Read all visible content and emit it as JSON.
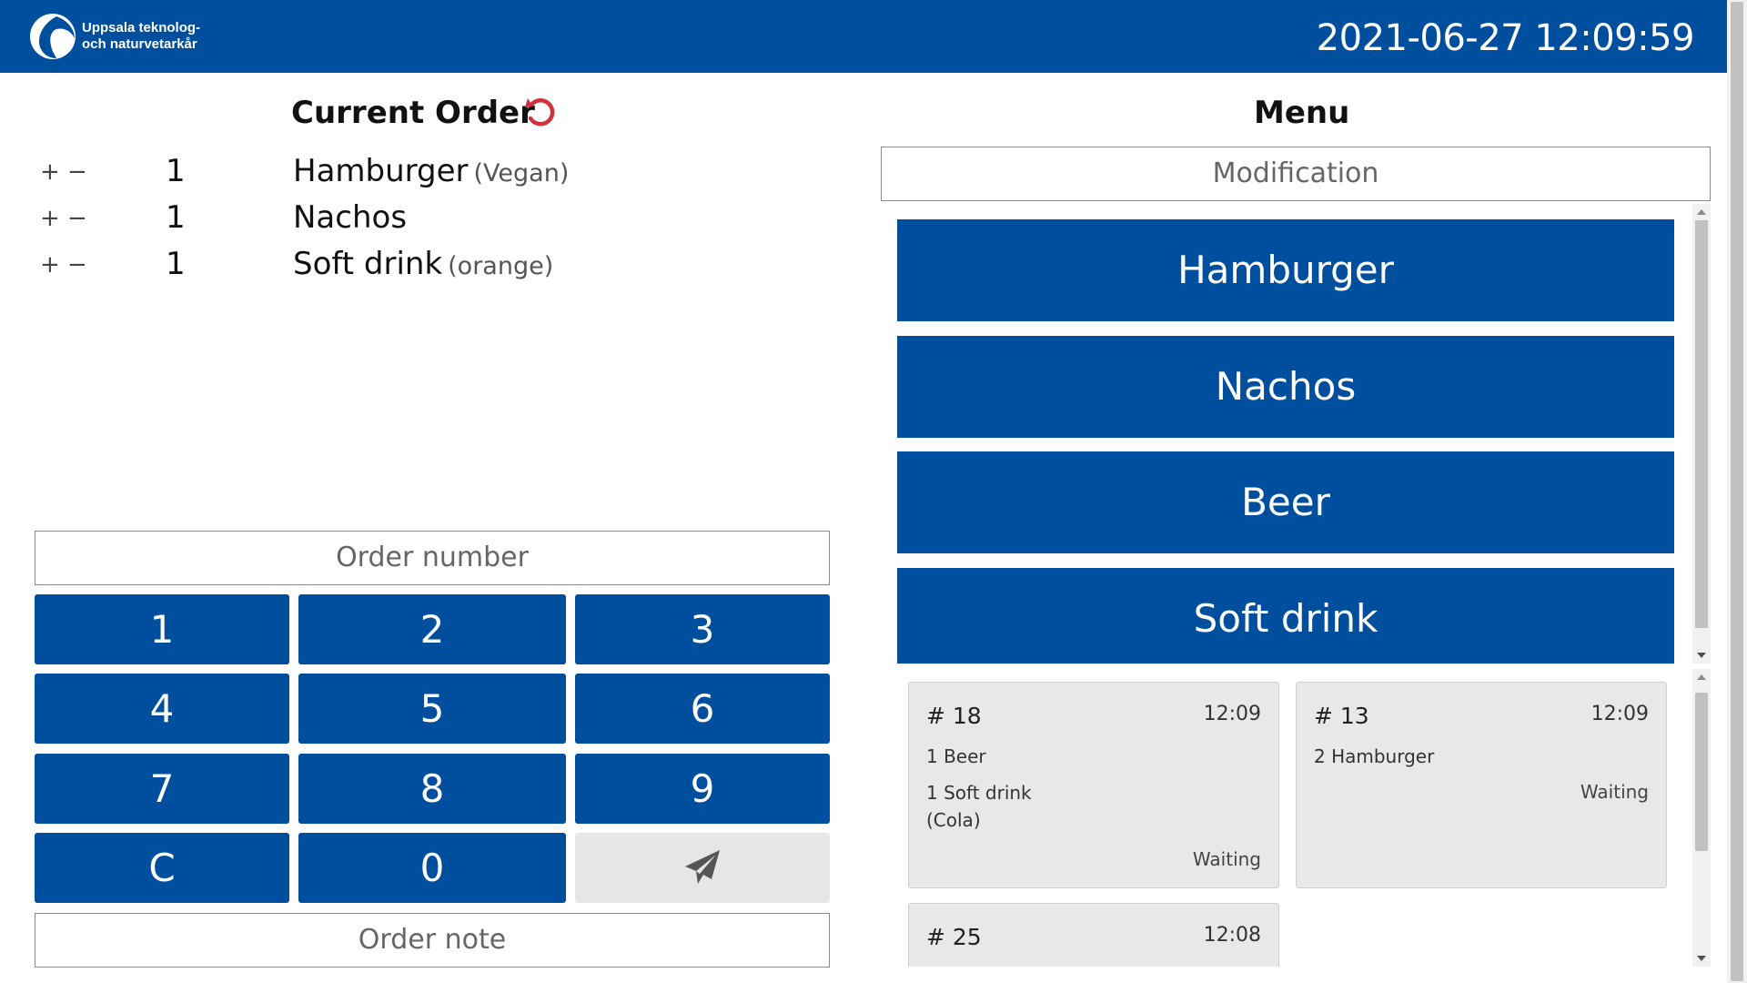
{
  "header": {
    "logo_line1": "Uppsala teknolog-",
    "logo_line2": "och naturvetarkår",
    "clock": "2021-06-27 12:09:59",
    "bg_color": "#004f9e"
  },
  "current_order": {
    "title": "Current Order",
    "undo_icon": "undo-icon",
    "plus_label": "+",
    "minus_label": "−",
    "items": [
      {
        "qty": "1",
        "name": "Hamburger",
        "modifier": "(Vegan)"
      },
      {
        "qty": "1",
        "name": "Nachos",
        "modifier": ""
      },
      {
        "qty": "1",
        "name": "Soft drink",
        "modifier": "(orange)"
      }
    ]
  },
  "order_number": {
    "placeholder": "Order number"
  },
  "keypad": {
    "keys": [
      "1",
      "2",
      "3",
      "4",
      "5",
      "6",
      "7",
      "8",
      "9",
      "C",
      "0"
    ],
    "send_icon": "paper-plane-icon"
  },
  "order_note": {
    "placeholder": "Order note"
  },
  "menu": {
    "title": "Menu",
    "modification_placeholder": "Modification",
    "items": [
      "Hamburger",
      "Nachos",
      "Beer",
      "Soft drink"
    ]
  },
  "orders": [
    {
      "number": "# 18",
      "time": "12:09",
      "lines": [
        "1 Beer",
        "1 Soft drink",
        "(Cola)"
      ],
      "status": "Waiting"
    },
    {
      "number": "# 13",
      "time": "12:09",
      "lines": [
        "2 Hamburger"
      ],
      "status": "Waiting"
    },
    {
      "number": "# 25",
      "time": "12:08",
      "lines": [],
      "status": ""
    }
  ]
}
